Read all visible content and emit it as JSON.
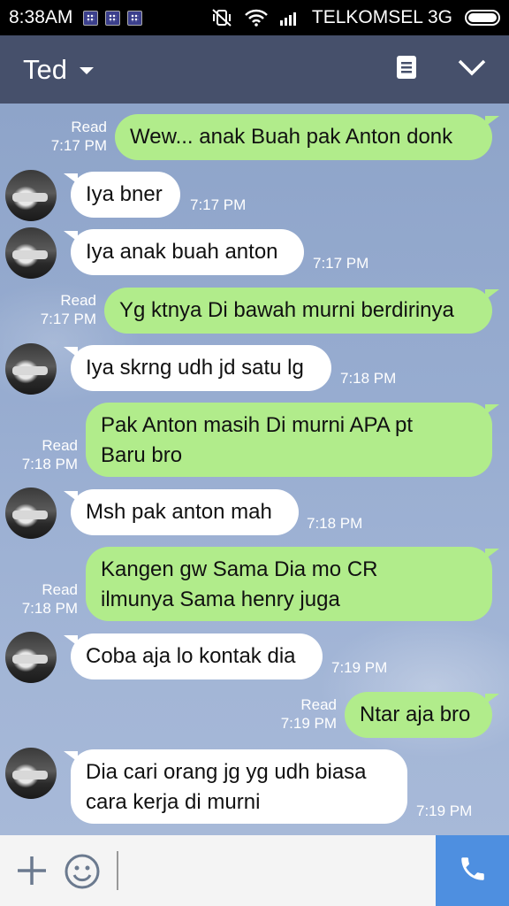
{
  "status_bar": {
    "time": "8:38AM",
    "carrier": "TELKOMSEL 3G",
    "icons": [
      "bbm-icon",
      "bbm-icon",
      "bbm-icon",
      "vibrate-off-icon",
      "wifi-icon",
      "signal-icon",
      "battery-icon"
    ]
  },
  "header": {
    "title": "Ted",
    "icons": [
      "dropdown-caret-icon",
      "note-icon",
      "chevron-down-icon"
    ],
    "color": "#46506b"
  },
  "messages": [
    {
      "dir": "out",
      "text": "Wew... anak Buah pak Anton donk",
      "read": "Read",
      "time": "7:17 PM"
    },
    {
      "dir": "in",
      "text": "Iya bner",
      "time": "7:17 PM"
    },
    {
      "dir": "in",
      "text": "Iya anak buah anton",
      "time": "7:17 PM"
    },
    {
      "dir": "out",
      "text": "Yg ktnya Di bawah murni berdirinya",
      "read": "Read",
      "time": "7:17 PM"
    },
    {
      "dir": "in",
      "text": "Iya skrng udh jd satu lg",
      "time": "7:18 PM"
    },
    {
      "dir": "out",
      "text_lines": [
        "Pak Anton masih Di murni APA pt",
        "Baru bro"
      ],
      "read": "Read",
      "time": "7:18 PM"
    },
    {
      "dir": "in",
      "text": "Msh pak anton mah",
      "time": "7:18 PM"
    },
    {
      "dir": "out",
      "text_lines": [
        "Kangen gw Sama Dia mo CR",
        "ilmunya Sama henry juga"
      ],
      "read": "Read",
      "time": "7:18 PM"
    },
    {
      "dir": "in",
      "text": "Coba aja lo kontak dia",
      "time": "7:19 PM"
    },
    {
      "dir": "out",
      "text": "Ntar aja bro",
      "read": "Read",
      "time": "7:19 PM"
    },
    {
      "dir": "in",
      "text_lines": [
        "Dia cari orang jg yg udh biasa",
        "cara kerja di murni"
      ],
      "time": "7:19 PM"
    }
  ],
  "input_bar": {
    "icons": [
      "plus-icon",
      "emoji-icon",
      "phone-icon"
    ],
    "call_color": "#4e8fe0"
  },
  "colors": {
    "outgoing_bubble": "#b1ec8b",
    "incoming_bubble": "#ffffff",
    "chat_background": "#97acd0"
  }
}
